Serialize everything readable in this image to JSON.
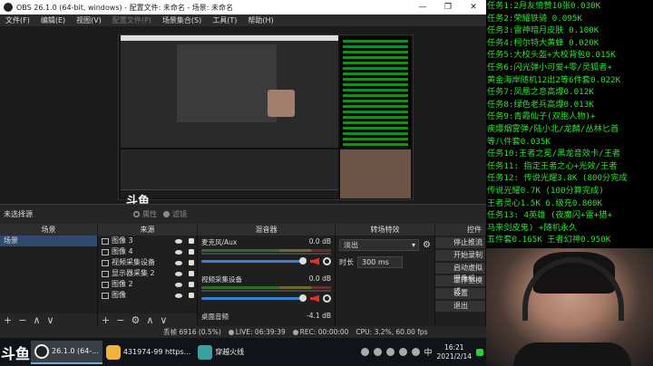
{
  "window": {
    "title": "OBS 26.1.0 (64-bit, windows) - 配置文件: 未命名 - 场景: 未命名",
    "minimize": "—",
    "maximize": "❐",
    "close": "✕"
  },
  "menu": [
    {
      "label": "文件(F)",
      "enabled": true
    },
    {
      "label": "编辑(E)",
      "enabled": true
    },
    {
      "label": "视图(V)",
      "enabled": true
    },
    {
      "label": "配置文件(P)",
      "enabled": false
    },
    {
      "label": "场景集合(S)",
      "enabled": true
    },
    {
      "label": "工具(T)",
      "enabled": true
    },
    {
      "label": "帮助(H)",
      "enabled": true
    }
  ],
  "preview": {
    "logo": "斗鱼"
  },
  "toolbar": {
    "no_source": "未选择源",
    "properties": "属性",
    "filters": "滤镜"
  },
  "docks": {
    "scenes": "场景",
    "sources": "来源",
    "mixer": "混音器",
    "transitions": "转场特效",
    "controls": "控件"
  },
  "scenes": [
    {
      "label": "场景",
      "selected": true
    }
  ],
  "sources": [
    {
      "label": "图像 3"
    },
    {
      "label": "图像 4"
    },
    {
      "label": "视频采集设备"
    },
    {
      "label": "显示器采集 2"
    },
    {
      "label": "图像 2"
    },
    {
      "label": "图像"
    }
  ],
  "mixer": [
    {
      "name": "麦克风/Aux",
      "db": "0.0 dB"
    },
    {
      "name": "视频采集设备",
      "db": "0.0 dB"
    },
    {
      "name": "桌面音频",
      "db": "-4.1 dB"
    }
  ],
  "transitions": {
    "type": "淡出",
    "duration_label": "时长",
    "duration_value": "300 ms"
  },
  "controls": [
    "停止推流",
    "开始录制",
    "启动虚拟摄像机",
    "工作室模式",
    "设置",
    "退出"
  ],
  "status": {
    "dropped": "丢帧 6916 (0.5%)",
    "live": "LIVE: 06:39:39",
    "rec": "REC: 00:00:00",
    "cpu": "CPU: 3.2%, 60.00 fps"
  },
  "taskbar": {
    "logo": "斗鱼",
    "items": [
      {
        "label": "26.1.0 (64-..."
      },
      {
        "label": "431974-99 https..."
      },
      {
        "label": "穿越火线"
      }
    ],
    "ime": "中",
    "time": "16:21",
    "date": "2021/2/14"
  },
  "tasks": [
    "任务1:2月友情赞10张0.030K",
    "任务2:荣耀铁骑 0.095K",
    "任务3:雷神暗月皮肤 0.100K",
    "任务4:柯尔特大黄蜂 0.020K",
    "任务5:大校头盔+大校背包0.015K",
    "任务6:闪光弹小可爱+零/灵狐者+",
    "黄金海岸随机12出2等6件套0.022K",
    "任务7:凤凰之息高爆0.012K",
    "任务8:绿色老兵高爆0.013K",
    "任务9:青霞仙子(双胞人物)+",
    "疾爆烟雾弹/陆小北/龙麟/丛林匕首",
    "等八件套0.035K",
    "任务10:王者之冕/黑龙音效卡/王者",
    "任务11: 指定王者之心+光效/王者",
    "任务12: 传说光耀3.8K (800分完成",
    "传说光耀0.7K (100分算完成)",
    "王者灵心1.5K  6.级充0.800K",
    "任务13: 4英雄 (夜魔闪+雷+猎+",
    "马来剑皮鬼) +随机永久",
    "五件套0.165K 王者幻神0.950K"
  ]
}
